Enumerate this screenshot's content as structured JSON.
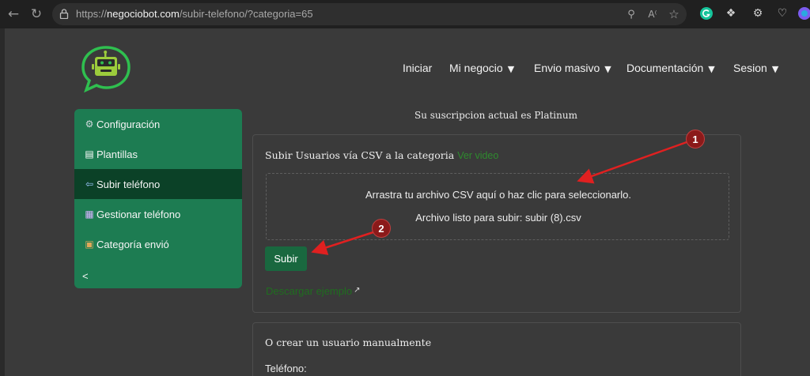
{
  "browser": {
    "url_prefix": "https://",
    "url_host": "negociobot.com",
    "url_path": "/subir-telefono/?categoria=65",
    "icons": [
      "back-icon",
      "reload-icon",
      "lock-icon",
      "zoom-icon",
      "read-aloud-icon",
      "favorite-star-icon",
      "grammarly-icon",
      "extensions-icon",
      "performance-icon",
      "health-icon",
      "copilot-icon"
    ]
  },
  "nav": {
    "items": [
      {
        "label": "Iniciar",
        "has_caret": false
      },
      {
        "label": "Mi negocio",
        "has_caret": true
      },
      {
        "label": "Envio masivo",
        "has_caret": true
      },
      {
        "label": "Documentación",
        "has_caret": true
      },
      {
        "label": "Sesion",
        "has_caret": true
      }
    ],
    "caret": "▼"
  },
  "sidebar": {
    "items": [
      {
        "label": "Configuración",
        "icon": "gear-icon",
        "glyph": "⚙"
      },
      {
        "label": "Plantillas",
        "icon": "document-icon",
        "glyph": "▤"
      },
      {
        "label": "Subir teléfono",
        "icon": "inbox-arrow-icon",
        "glyph": "⇦",
        "active": true
      },
      {
        "label": "Gestionar teléfono",
        "icon": "abacus-icon",
        "glyph": "▦"
      },
      {
        "label": "Categoría envió",
        "icon": "package-icon",
        "glyph": "▣"
      }
    ],
    "collapse_label": "<"
  },
  "subscription_text": "Su suscripcion actual es Platinum",
  "upload_card": {
    "title": "Subir Usuarios vía CSV a la categoria",
    "video_link": "Ver video",
    "dropzone_text": "Arrastra tu archivo CSV aquí o haz clic para seleccionarlo.",
    "ready_text": "Archivo listo para subir: subir (8).csv",
    "upload_button": "Subir",
    "download_link": "Descargar ejemplo"
  },
  "manual_card": {
    "title": "O crear un usuario manualmente",
    "phone_label": "Teléfono:"
  },
  "annotations": {
    "badge1": "1",
    "badge2": "2"
  },
  "colors": {
    "brand_green": "#1d7c52",
    "active_green": "#0b4127",
    "button_green": "#19683f",
    "annotation_red": "#e02020"
  }
}
